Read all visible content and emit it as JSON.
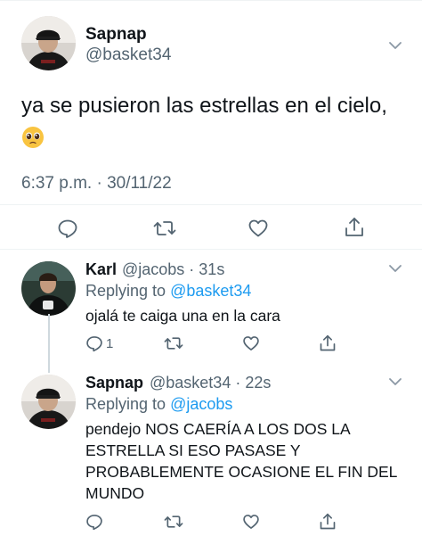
{
  "main_tweet": {
    "name": "Sapnap",
    "handle": "@basket34",
    "text": "ya se pusieron las estrellas en el cielo,",
    "emoji": "pleading-face-emoji",
    "timestamp": "6:37 p.m. · 30/11/22"
  },
  "replies": [
    {
      "name": "Karl",
      "handle": "@jacobs · 31s",
      "replying_prefix": "Replying to ",
      "replying_to": "@basket34",
      "text": "ojalá te caiga una en la cara",
      "reply_count": "1"
    },
    {
      "name": "Sapnap",
      "handle": "@basket34 · 22s",
      "replying_prefix": "Replying to ",
      "replying_to": "@jacobs",
      "text_lines": [
        "pendejo NOS CAERÍA A LOS DOS LA",
        "ESTRELLA SI ESO PASASE Y",
        "PROBABLEMENTE OCASIONE EL FIN DEL",
        "MUNDO"
      ]
    }
  ],
  "icons": {
    "reply": "reply-icon",
    "retweet": "retweet-icon",
    "like": "like-icon",
    "share": "share-icon",
    "more": "chevron-down-icon"
  },
  "colors": {
    "text": "#0f1419",
    "secondary": "#536471",
    "link": "#1d9bf0",
    "divider": "#eff3f4"
  }
}
